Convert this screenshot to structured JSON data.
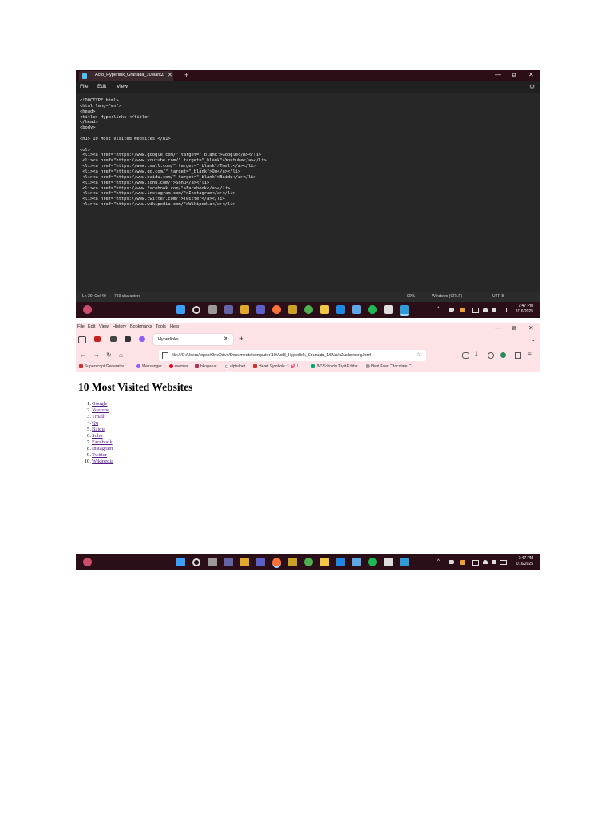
{
  "notepad": {
    "tab_title": "Act8_Hyperlink_Granada_10MarkZ",
    "tab_close": "✕",
    "new_tab": "+",
    "controls": {
      "minimize": "—",
      "maximize": "⧉",
      "close": "✕"
    },
    "menu": [
      "File",
      "Edit",
      "View"
    ],
    "settings_icon": "⚙",
    "code_lines": [
      "<!DOCTYPE html>",
      "<html lang=\"en\">",
      "<head>",
      "<title> Hyperlinks </title>",
      "</head>",
      "<body>",
      "",
      "<h1> 10 Most Visited Websites </h1>",
      "",
      "<ol>",
      " <li><a href=\"https://www.google.com/\" target=\"_blank\">Google</a></li>",
      " <li><a href=\"https://www.youtube.com/\" target=\"_blank\">Youtube</a></li>",
      " <li><a href=\"https://www.tmall.com/\" target=\"_blank\">Tmall</a></li>",
      " <li><a href=\"https://www.qq.com/\" target=\"_blank\">Qq</a></li>",
      " <li><a href=\"https://www.baidu.com/\" target=\"_blank\">Baidu</a></li>",
      " <li><a href=\"https://www.sohu.com/\">Sohu</a></li>",
      " <li><a href=\"https://www.facebook.com/\">Facebook</a></li>",
      " <li><a href=\"https://www.instagram.com/\">Instagram</a></li>",
      " <li><a href=\"https://www.twitter.com/\">Twitter</a></li>",
      " <li><a href=\"https://www.wikipedia.com/\">Wikipedia</a></li>"
    ],
    "status": {
      "position": "Ln 20, Col 40",
      "characters": "759 characters",
      "zoom": "90%",
      "line_ending": "Windows (CRLF)",
      "encoding": "UTF-8"
    }
  },
  "taskbar": {
    "time": "7:47 PM",
    "date": "2/16/2025",
    "tray_caret": "^"
  },
  "firefox": {
    "menu": [
      "File",
      "Edit",
      "View",
      "History",
      "Bookmarks",
      "Tools",
      "Help"
    ],
    "tab_title": "Hyperlinks",
    "tab_close": "✕",
    "new_tab": "+",
    "list_all_tabs": "⌄",
    "url": "file:///C:/Users/topsp/OneDrive/Documents/computer 10/Act8_Hyperlink_Granada_10MarkZuckerberg.html",
    "bookmarks": [
      "Superscript Generator ...",
      "Messenger",
      "memes",
      "hkoganat",
      "alphabet",
      "Heart Symbols ♡ 💕 / ...",
      "W3Schools Tryit Editor",
      "Best Ever Chocolate C..."
    ],
    "page": {
      "heading": "10 Most Visited Websites",
      "links": [
        "Google",
        "Youtube",
        "Tmall",
        "Qq",
        "Baidu",
        "Sohu",
        "Facebook",
        "Instagram",
        "Twitter",
        "Wikipedia"
      ]
    }
  },
  "colors": {
    "titlebar": "#2b0e16",
    "editor_bg": "#272727",
    "taskbar": "#2a0f18",
    "firefox_chrome": "#fde3e6",
    "link_visited": "#551a8b"
  }
}
